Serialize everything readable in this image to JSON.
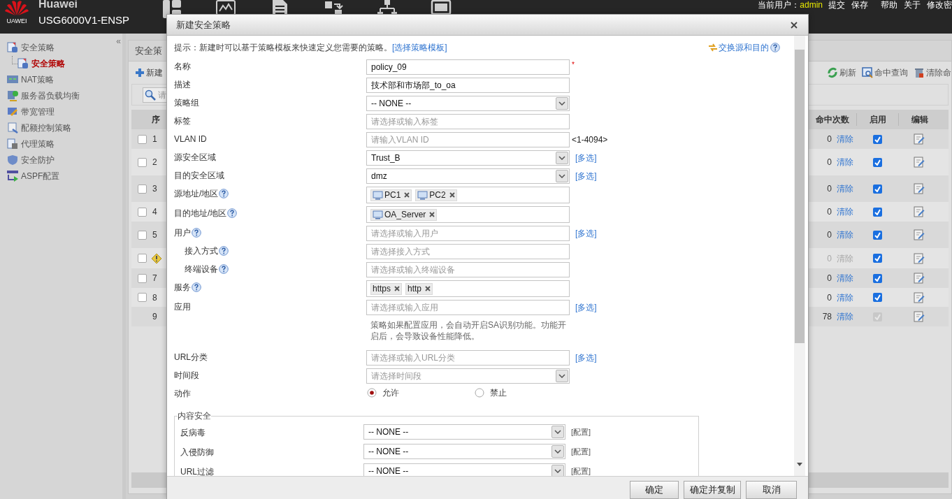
{
  "header": {
    "logo_text": "UAWEI",
    "brand": "Huawei",
    "device": "USG6000V1-ENSP",
    "user_label": "当前用户：",
    "user": "admin",
    "links": [
      "提交",
      "保存",
      "帮助",
      "关于",
      "修改密"
    ]
  },
  "sidebar": {
    "collapse": "«",
    "items": [
      {
        "label": "安全策略",
        "selected": false,
        "children": [
          {
            "label": "安全策略",
            "selected": true
          }
        ]
      },
      {
        "label": "NAT策略",
        "selected": false
      },
      {
        "label": "服务器负载均衡",
        "selected": false
      },
      {
        "label": "带宽管理",
        "selected": false
      },
      {
        "label": "配额控制策略",
        "selected": false
      },
      {
        "label": "代理策略",
        "selected": false
      },
      {
        "label": "安全防护",
        "selected": false
      },
      {
        "label": "ASPF配置",
        "selected": false
      }
    ]
  },
  "panel": {
    "tab": "安全策",
    "new_button": "新建",
    "search_placeholder": "请",
    "toolbar_right": [
      "刷新",
      "命中查询",
      "清除命"
    ],
    "table": {
      "columns": [
        "序",
        "命中次数",
        "启用",
        "编辑"
      ],
      "rows": [
        {
          "kind": "policy",
          "seq": "1",
          "checked": false,
          "warning": false,
          "disabled": false,
          "hits": "0",
          "clear": "清除",
          "enabled": true
        },
        {
          "kind": "policy",
          "seq": "2",
          "checked": false,
          "warning": false,
          "disabled": false,
          "hits": "0",
          "clear": "清除",
          "enabled": true
        },
        {
          "kind": "policy",
          "seq": "3",
          "checked": false,
          "warning": false,
          "disabled": false,
          "hits": "0",
          "clear": "清除",
          "enabled": true
        },
        {
          "kind": "policy",
          "seq": "4",
          "checked": false,
          "warning": false,
          "disabled": false,
          "hits": "0",
          "clear": "清除",
          "enabled": true
        },
        {
          "kind": "policy",
          "seq": "5",
          "checked": false,
          "warning": false,
          "disabled": false,
          "hits": "0",
          "clear": "清除",
          "enabled": true
        },
        {
          "kind": "policy",
          "checked": false,
          "warning": true,
          "disabled": true,
          "hits": "0",
          "clear": "清除",
          "enabled": true
        },
        {
          "kind": "policy",
          "seq": "7",
          "checked": false,
          "warning": false,
          "disabled": false,
          "hits": "0",
          "clear": "清除",
          "enabled": true
        },
        {
          "kind": "policy",
          "seq": "8",
          "checked": false,
          "warning": false,
          "disabled": false,
          "hits": "0",
          "clear": "清除",
          "enabled": true
        },
        {
          "kind": "default",
          "seq": "9",
          "warning": false,
          "disabled": false,
          "hits": "78",
          "clear": "清除",
          "enabled": true
        }
      ]
    }
  },
  "dialog": {
    "title": "新建安全策略",
    "hint": "提示：新建时可以基于策略模板来快速定义您需要的策略。",
    "hint_link": "[选择策略模板]",
    "swap_link": "交换源和目的",
    "fields": [
      {
        "label": "名称",
        "kind": "text",
        "value": "policy_09",
        "required_mark": "*"
      },
      {
        "label": "描述",
        "kind": "text",
        "value": "技术部和市场部_to_oa"
      },
      {
        "label": "策略组",
        "kind": "select",
        "value": "-- NONE --"
      },
      {
        "label": "标签",
        "kind": "text",
        "placeholder": "请选择或输入标签"
      },
      {
        "label": "VLAN ID",
        "kind": "text",
        "placeholder": "请输入VLAN ID",
        "range": "<1-4094>"
      },
      {
        "label": "源安全区域",
        "kind": "select",
        "value": "Trust_B",
        "link": "[多选]"
      },
      {
        "label": "目的安全区域",
        "kind": "select",
        "value": "dmz",
        "link": "[多选]"
      },
      {
        "label": "源地址/地区",
        "kind": "tags",
        "help": true,
        "tags": [
          {
            "text": "PC1",
            "kind": "host"
          },
          {
            "text": "PC2",
            "kind": "host"
          }
        ]
      },
      {
        "label": "目的地址/地区",
        "kind": "tags",
        "help": true,
        "tags": [
          {
            "text": "OA_Server",
            "kind": "host"
          }
        ]
      },
      {
        "label": "用户",
        "kind": "text",
        "help": true,
        "placeholder": "请选择或输入用户",
        "link": "[多选]",
        "children": [
          {
            "label": "接入方式",
            "kind": "text",
            "help": true,
            "placeholder": "请选择接入方式"
          },
          {
            "label": "终端设备",
            "kind": "text",
            "help": true,
            "placeholder": "请选择或输入终端设备"
          }
        ]
      },
      {
        "label": "服务",
        "kind": "tags",
        "help": true,
        "tags": [
          {
            "text": "https",
            "kind": "plain"
          },
          {
            "text": "http",
            "kind": "plain"
          }
        ]
      },
      {
        "label": "应用",
        "kind": "text",
        "placeholder": "请选择或输入应用",
        "link": "[多选]",
        "note": "策略如果配置应用，会自动开启SA识别功能。功能开启后，会导致设备性能降低。"
      },
      {
        "label": "URL分类",
        "kind": "text",
        "placeholder": "请选择或输入URL分类",
        "link": "[多选]"
      },
      {
        "label": "时间段",
        "kind": "select",
        "placeholder": "请选择时间段"
      },
      {
        "label": "动作",
        "kind": "radio",
        "options": [
          {
            "label": "允许",
            "selected": true
          },
          {
            "label": "禁止",
            "selected": false
          }
        ]
      }
    ],
    "content_security": {
      "legend": "内容安全",
      "rows": [
        {
          "label": "反病毒",
          "value": "-- NONE --",
          "link": "[配置]"
        },
        {
          "label": "入侵防御",
          "value": "-- NONE --",
          "link": "[配置]"
        },
        {
          "label": "URL过滤",
          "value": "-- NONE --",
          "link": "[配置]"
        }
      ]
    },
    "buttons": [
      "确定",
      "确定并复制",
      "取消"
    ]
  }
}
